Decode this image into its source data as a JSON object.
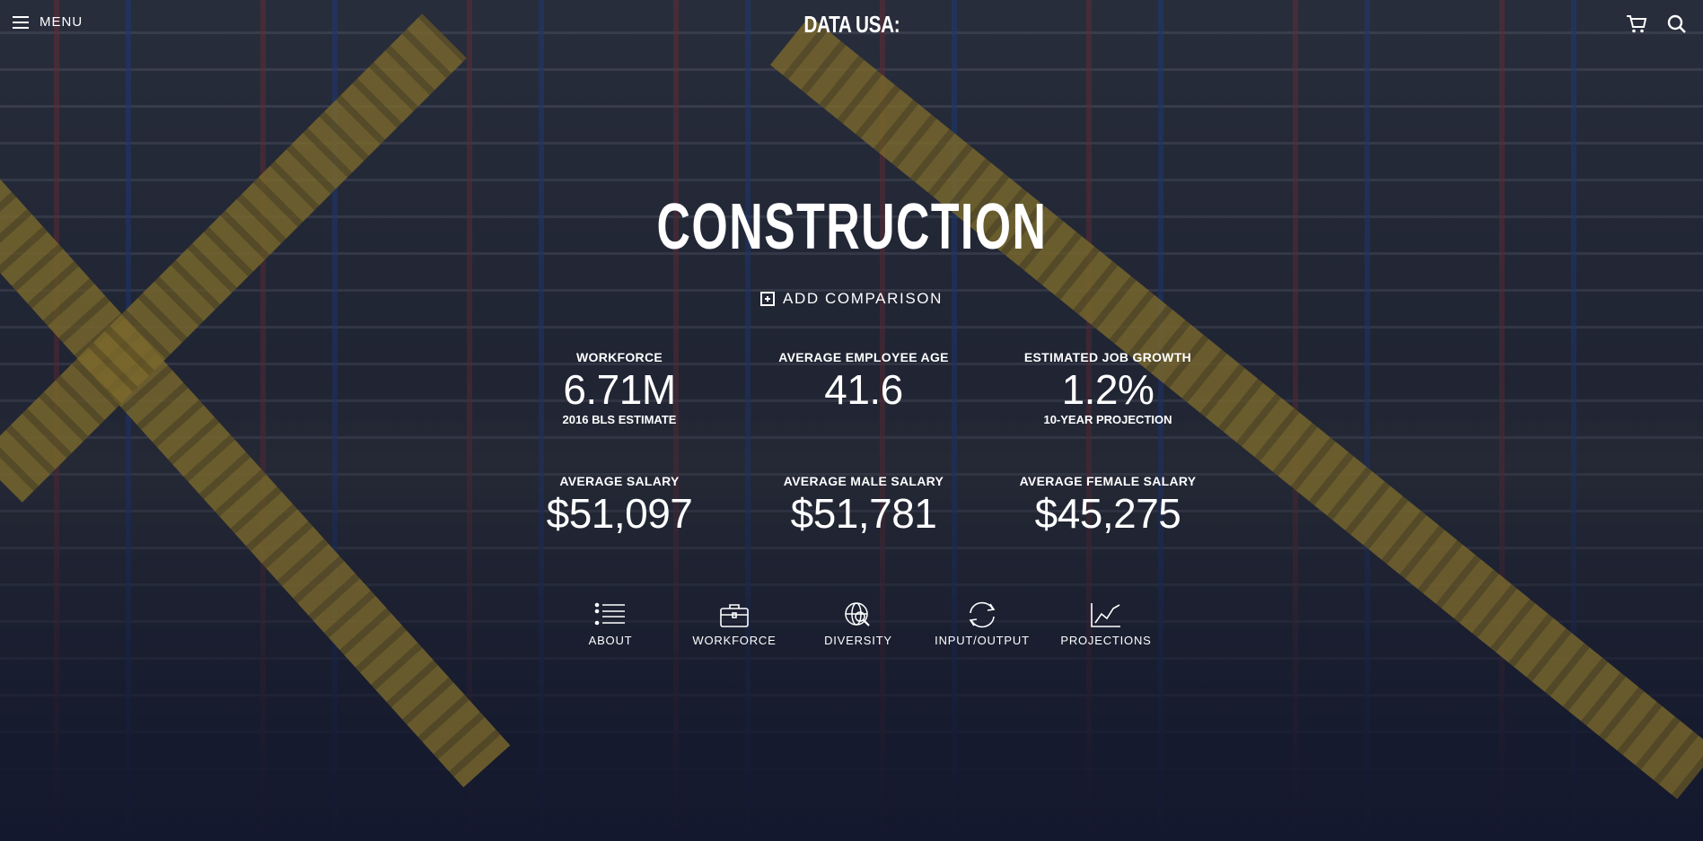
{
  "header": {
    "menu_label": "MENU",
    "logo": "DATA USA:",
    "icons": [
      "menu-icon",
      "cart-icon",
      "search-icon"
    ]
  },
  "profile": {
    "title": "CONSTRUCTION",
    "add_comparison": "ADD COMPARISON"
  },
  "stats": [
    {
      "label": "WORKFORCE",
      "value": "6.71M",
      "sub": "2016 BLS ESTIMATE"
    },
    {
      "label": "AVERAGE EMPLOYEE AGE",
      "value": "41.6",
      "sub": ""
    },
    {
      "label": "ESTIMATED JOB GROWTH",
      "value": "1.2%",
      "sub": "10-YEAR PROJECTION"
    },
    {
      "label": "AVERAGE SALARY",
      "value": "$51,097",
      "sub": ""
    },
    {
      "label": "AVERAGE MALE SALARY",
      "value": "$51,781",
      "sub": ""
    },
    {
      "label": "AVERAGE FEMALE SALARY",
      "value": "$45,275",
      "sub": ""
    }
  ],
  "sections": [
    {
      "label": "ABOUT",
      "icon": "list-icon"
    },
    {
      "label": "WORKFORCE",
      "icon": "briefcase-icon"
    },
    {
      "label": "DIVERSITY",
      "icon": "globe-search-icon"
    },
    {
      "label": "INPUT/OUTPUT",
      "icon": "cycle-arrows-icon"
    },
    {
      "label": "PROJECTIONS",
      "icon": "line-chart-icon"
    }
  ]
}
